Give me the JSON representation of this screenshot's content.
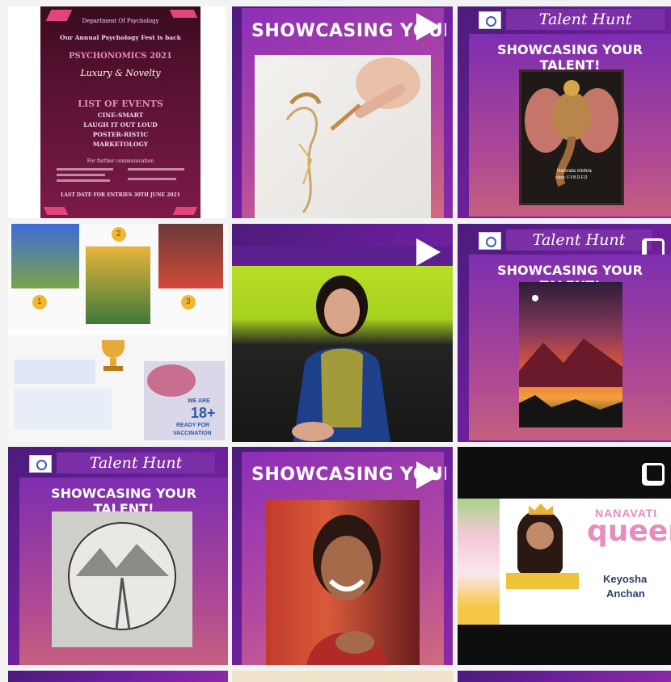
{
  "tiles": {
    "poster": {
      "department": "Department Of Psychology",
      "announcement": "Our Annual Psychology Fest is back",
      "fest_name": "PSYCHONOMICS 2021",
      "tagline": "Luxury & Novelty",
      "events_heading": "LIST OF EVENTS",
      "events": [
        "CINE-SMART",
        "LAUGH IT OUT LOUD",
        "POSTER-RISTIC",
        "MARKETOLOGY"
      ],
      "contact_heading": "For further communication",
      "deadline": "LAST DATE FOR ENTRIES 30TH JUNE 2021"
    },
    "video1": {
      "title": "SHOWCASING YOUR TALENT"
    },
    "talent1": {
      "header": "Talent Hunt",
      "subtitle": "SHOWCASING YOUR TALENT!",
      "caption1": "Namrata mishra",
      "caption2": "class: F.Y.B.D.F.D"
    },
    "collage": {
      "badge_numbers": [
        "2",
        "1",
        "3"
      ],
      "vaccine_text1": "WE ARE",
      "vaccine_text2": "18+",
      "vaccine_text3": "READY FOR",
      "vaccine_text4": "VACCINATION"
    },
    "video2": {},
    "talent2": {
      "header": "Talent Hunt",
      "subtitle": "SHOWCASING YOUR TALENT!"
    },
    "talent3": {
      "header": "Talent Hunt",
      "subtitle": "SHOWCASING YOUR TALENT!"
    },
    "video3": {
      "title": "SHOWCASING YOUR TALENT"
    },
    "queen": {
      "brand": "NANAVATI",
      "title": "queen",
      "name_line1": "Keyosha",
      "name_line2": "Anchan"
    }
  },
  "colors": {
    "accent_purple": "#6a1f9a",
    "poster_maroon": "#5a1232",
    "queen_pink": "#e88bc0"
  }
}
